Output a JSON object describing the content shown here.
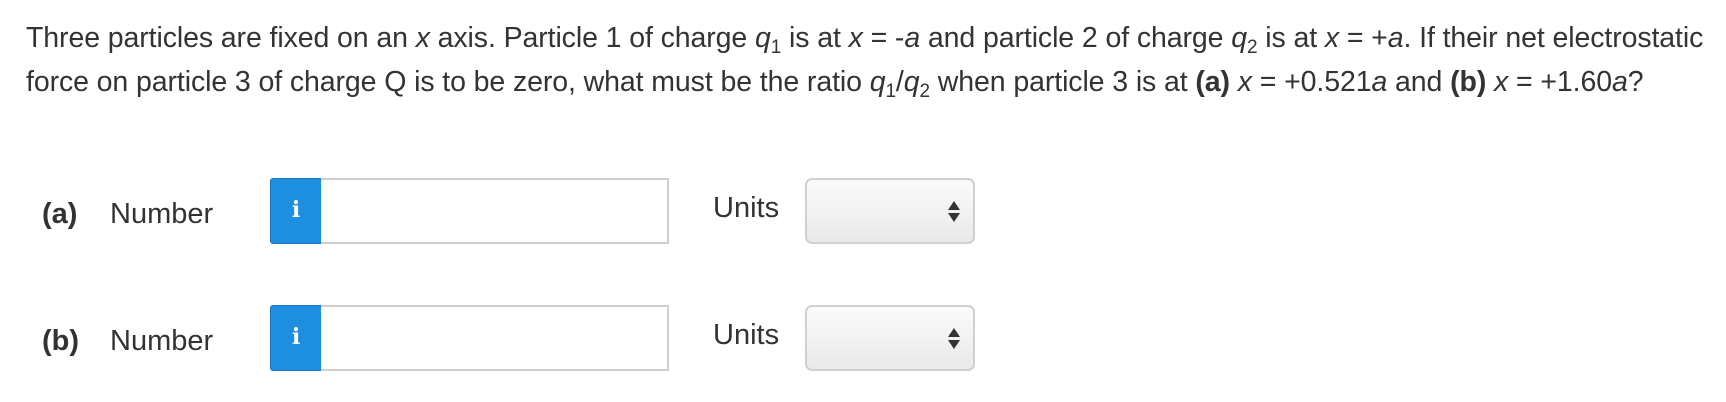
{
  "question": {
    "t1": "Three particles are fixed on an ",
    "x1": "x",
    "t2": " axis. Particle 1 of charge ",
    "q1a": "q",
    "q1a_sub": "1",
    "t3": " is at ",
    "x2": "x",
    "t4": " = -",
    "a1": "a",
    "t5": " and particle 2 of charge ",
    "q2a": "q",
    "q2a_sub": "2",
    "t6": " is at ",
    "x3": "x",
    "t7": " = +",
    "a2": "a",
    "t8": ". If their net electrostatic force on particle 3 of charge Q is to be zero, what must be the ratio ",
    "q1b": "q",
    "q1b_sub": "1",
    "slash": "/",
    "q2b": "q",
    "q2b_sub": "2",
    "t9": " when particle 3 is at ",
    "part_a": "(a)",
    "x4": " x",
    "t10": " = +0.521",
    "a3": "a",
    "t11": " and ",
    "part_b": "(b)",
    "x5": " x",
    "t12": " = +1.60",
    "a4": "a",
    "t13": "?"
  },
  "rows": [
    {
      "part_label": "(a)",
      "number_label": "Number",
      "info_glyph": "i",
      "value": "",
      "units_label": "Units",
      "units_selected": ""
    },
    {
      "part_label": "(b)",
      "number_label": "Number",
      "info_glyph": "i",
      "value": "",
      "units_label": "Units",
      "units_selected": ""
    }
  ],
  "colors": {
    "info_button": "#1e8fe0",
    "text": "#333333"
  },
  "icons": {
    "info": "info-icon",
    "select_arrows": "updown-arrows-icon"
  }
}
